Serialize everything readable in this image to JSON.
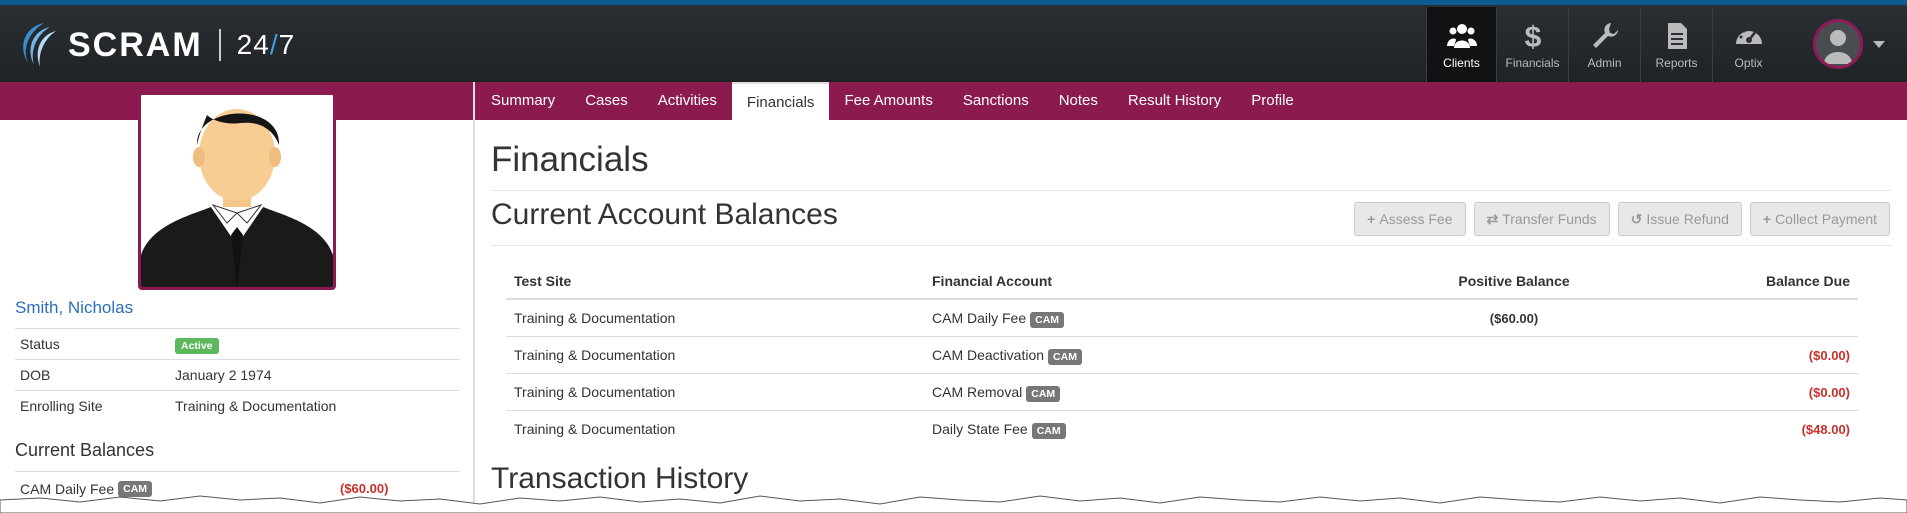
{
  "brand": {
    "logo_text": "SCRAM",
    "logo_247_a": "24",
    "logo_247_slash": "/",
    "logo_247_b": "7"
  },
  "topnav": {
    "items": [
      {
        "label": "Clients",
        "icon": "users-icon",
        "active": true
      },
      {
        "label": "Financials",
        "icon": "dollar-icon",
        "active": false
      },
      {
        "label": "Admin",
        "icon": "wrench-icon",
        "active": false
      },
      {
        "label": "Reports",
        "icon": "document-icon",
        "active": false
      },
      {
        "label": "Optix",
        "icon": "gauge-icon",
        "active": false
      }
    ]
  },
  "tabs": [
    "Summary",
    "Cases",
    "Activities",
    "Financials",
    "Fee Amounts",
    "Sanctions",
    "Notes",
    "Result History",
    "Profile"
  ],
  "active_tab": "Financials",
  "client": {
    "name": "Smith, Nicholas",
    "fields": [
      {
        "label": "Status",
        "value": "Active"
      },
      {
        "label": "DOB",
        "value": "January 2 1974"
      },
      {
        "label": "Enrolling Site",
        "value": "Training & Documentation"
      }
    ],
    "current_balances_title": "Current Balances",
    "balances": [
      {
        "account": "CAM Daily Fee",
        "badge": "CAM",
        "amount": "($60.00)"
      }
    ]
  },
  "main": {
    "title": "Financials",
    "balances_title": "Current Account Balances",
    "actions": [
      {
        "icon": "+",
        "label": "Assess Fee"
      },
      {
        "icon": "⇄",
        "label": "Transfer Funds"
      },
      {
        "icon": "↺",
        "label": "Issue Refund"
      },
      {
        "icon": "+",
        "label": "Collect Payment"
      }
    ],
    "table": {
      "headers": [
        "Test Site",
        "Financial Account",
        "Positive Balance",
        "Balance Due"
      ],
      "rows": [
        {
          "site": "Training & Documentation",
          "account": "CAM Daily Fee",
          "badge": "CAM",
          "positive": "($60.00)",
          "due": ""
        },
        {
          "site": "Training & Documentation",
          "account": "CAM Deactivation",
          "badge": "CAM",
          "positive": "",
          "due": "($0.00)"
        },
        {
          "site": "Training & Documentation",
          "account": "CAM Removal",
          "badge": "CAM",
          "positive": "",
          "due": "($0.00)"
        },
        {
          "site": "Training & Documentation",
          "account": "Daily State Fee",
          "badge": "CAM",
          "positive": "",
          "due": "($48.00)"
        }
      ]
    },
    "history_title": "Transaction History"
  },
  "colors": {
    "accent": "#8b1a4f",
    "nav_bg": "#2b2f33",
    "link": "#2a6ebb",
    "danger": "#c9302c",
    "success": "#5cb85c"
  }
}
